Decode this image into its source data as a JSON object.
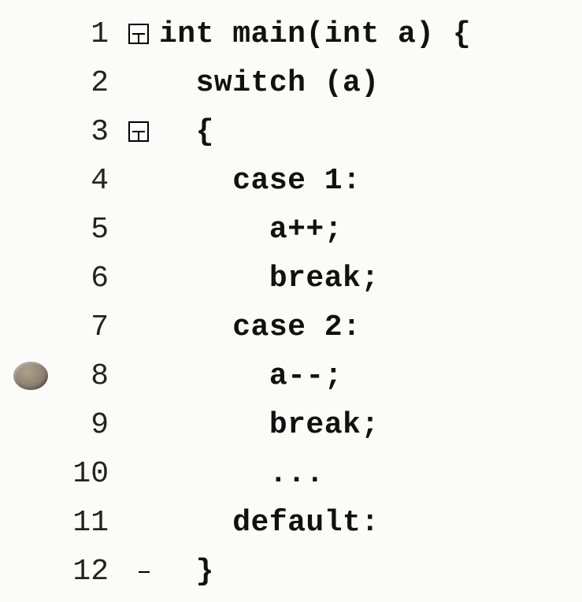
{
  "lines": [
    {
      "n": "1",
      "fold": "box-start",
      "bp": false,
      "code": "int main(int a) {"
    },
    {
      "n": "2",
      "fold": "line",
      "bp": false,
      "code": "  switch (a)"
    },
    {
      "n": "3",
      "fold": "box-mid",
      "bp": false,
      "code": "  {"
    },
    {
      "n": "4",
      "fold": "line",
      "bp": false,
      "code": "    case 1:"
    },
    {
      "n": "5",
      "fold": "line",
      "bp": false,
      "code": "      a++;"
    },
    {
      "n": "6",
      "fold": "line",
      "bp": false,
      "code": "      break;"
    },
    {
      "n": "7",
      "fold": "line",
      "bp": false,
      "code": "    case 2:"
    },
    {
      "n": "8",
      "fold": "line",
      "bp": true,
      "code": "      a--;"
    },
    {
      "n": "9",
      "fold": "line",
      "bp": false,
      "code": "      break;"
    },
    {
      "n": "10",
      "fold": "line",
      "bp": false,
      "code": "      ..."
    },
    {
      "n": "11",
      "fold": "line",
      "bp": false,
      "code": "    default:"
    },
    {
      "n": "12",
      "fold": "end",
      "bp": false,
      "code": "  }"
    }
  ]
}
